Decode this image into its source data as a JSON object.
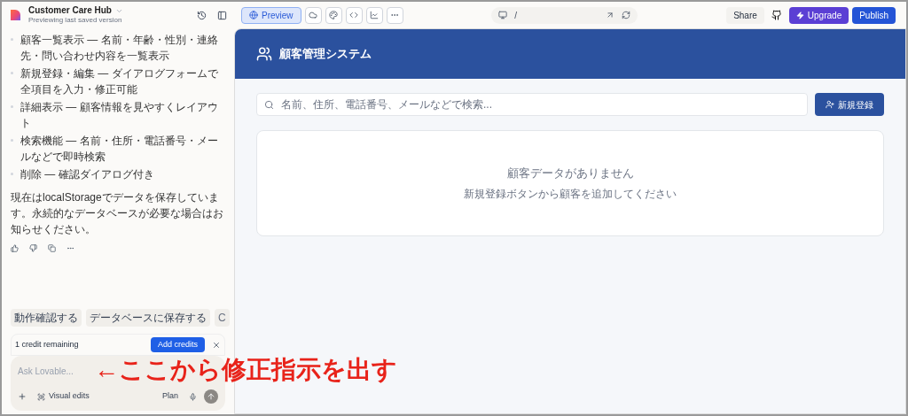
{
  "project": {
    "name": "Customer Care Hub",
    "subtitle": "Previewing last saved version"
  },
  "chat": {
    "features": [
      "顧客一覧表示 — 名前・年齢・性別・連絡先・問い合わせ内容を一覧表示",
      "新規登録・編集 — ダイアログフォームで全項目を入力・修正可能",
      "詳細表示 — 顧客情報を見やすくレイアウト",
      "検索機能 — 名前・住所・電話番号・メールなどで即時検索",
      "削除 — 確認ダイアログ付き"
    ],
    "message": "現在はlocalStorageでデータを保存しています。永続的なデータベースが必要な場合はお知らせください。",
    "suggestions": [
      "動作確認する",
      "データベースに保存する",
      "C"
    ],
    "credits": {
      "text": "1 credit remaining",
      "button": "Add credits"
    },
    "input": {
      "placeholder": "Ask Lovable...",
      "visual_edits": "Visual edits",
      "plan": "Plan"
    }
  },
  "annotation": "←ここから修正指示を出す",
  "toolbar": {
    "preview": "Preview",
    "preview_selected": true,
    "path": "/",
    "share": "Share",
    "upgrade": "Upgrade",
    "publish": "Publish"
  },
  "app": {
    "title": "顧客管理システム",
    "search_placeholder": "名前、住所、電話番号、メールなどで検索...",
    "new_button": "新規登録",
    "empty_title": "顧客データがありません",
    "empty_hint": "新規登録ボタンから顧客を追加してください"
  }
}
